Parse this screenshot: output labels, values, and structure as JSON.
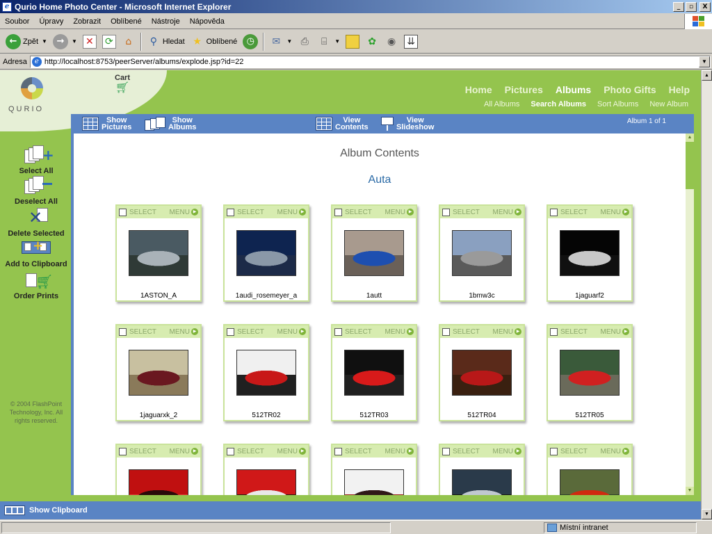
{
  "window": {
    "title": "Qurio Home Photo Center - Microsoft Internet Explorer",
    "buttons": [
      "_",
      "▫",
      "X"
    ]
  },
  "menu": [
    "Soubor",
    "Úpravy",
    "Zobrazit",
    "Oblíbené",
    "Nástroje",
    "Nápověda"
  ],
  "toolbar": {
    "back_label": "Zpět",
    "search_label": "Hledat",
    "favorites_label": "Oblíbené"
  },
  "address": {
    "label": "Adresa",
    "url": "http://localhost:8753/peerServer/albums/explode.jsp?id=22"
  },
  "header": {
    "logo_text": "QURIO",
    "cart_label": "Cart",
    "nav": [
      "Home",
      "Pictures",
      "Albums",
      "Photo Gifts",
      "Help"
    ],
    "active_nav": "Albums",
    "subnav": [
      "All Albums",
      "Search Albums",
      "Sort Albums",
      "New Album"
    ],
    "active_subnav": "Search Albums"
  },
  "sidebar": {
    "actions": [
      "Select All",
      "Deselect All",
      "Delete Selected",
      "Add to Clipboard",
      "Order Prints"
    ],
    "copyright": "© 2004 FlashPoint Technology, Inc. All rights reserved."
  },
  "panel": {
    "show_pictures": [
      "Show",
      "Pictures"
    ],
    "show_albums": [
      "Show",
      "Albums"
    ],
    "view_contents": [
      "View",
      "Contents"
    ],
    "view_slideshow": [
      "View",
      "Slideshow"
    ],
    "album_count": "Album 1 of 1",
    "heading": "Album Contents",
    "album_name": "Auta"
  },
  "card_labels": {
    "select": "SELECT",
    "menu": "MENU"
  },
  "photos": [
    {
      "name": "1ASTON_A",
      "colors": [
        "#4a5a62",
        "#a9b2b8",
        "#2f3a36"
      ]
    },
    {
      "name": "1audi_rosemeyer_a",
      "colors": [
        "#0e2450",
        "#8a98a8",
        "#1c2a48"
      ]
    },
    {
      "name": "1autt",
      "colors": [
        "#a89a8e",
        "#1e4fb0",
        "#6a6058"
      ]
    },
    {
      "name": "1bmw3c",
      "colors": [
        "#8aa0c0",
        "#9a9a9a",
        "#5a5a5a"
      ]
    },
    {
      "name": "1jaguarf2",
      "colors": [
        "#050505",
        "#c8c8c8",
        "#101010"
      ]
    },
    {
      "name": "1jaguarxk_2",
      "colors": [
        "#c8c0a0",
        "#6a1820",
        "#8a7a5a"
      ]
    },
    {
      "name": "512TR02",
      "colors": [
        "#f0f0f0",
        "#c81818",
        "#202020"
      ]
    },
    {
      "name": "512TR03",
      "colors": [
        "#101010",
        "#d81a1a",
        "#202020"
      ]
    },
    {
      "name": "512TR04",
      "colors": [
        "#5a2a1a",
        "#b81818",
        "#3a2010"
      ]
    },
    {
      "name": "512TR05",
      "colors": [
        "#3a5a3a",
        "#d02020",
        "#6a6a5a"
      ]
    },
    {
      "name": "",
      "colors": [
        "#c01010",
        "#2a0a0a",
        "#e03030"
      ]
    },
    {
      "name": "",
      "colors": [
        "#d01818",
        "#e8e8e8",
        "#301010"
      ]
    },
    {
      "name": "",
      "colors": [
        "#f2f2f2",
        "#301818",
        "#a01818"
      ]
    },
    {
      "name": "",
      "colors": [
        "#2a3a4a",
        "#c0c8d0",
        "#101010"
      ]
    },
    {
      "name": "",
      "colors": [
        "#5a6a3a",
        "#d02a10",
        "#2a3a2a"
      ]
    }
  ],
  "clipboard_label": "Show Clipboard",
  "status": {
    "zone": "Místní intranet"
  }
}
